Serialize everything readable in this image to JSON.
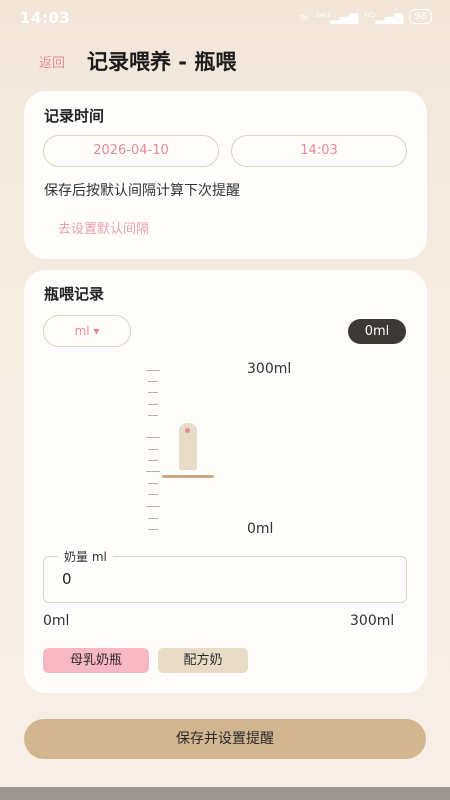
{
  "status_bar": {
    "time": "14:03",
    "signal_1": "ˢ⁴ᴳ▂▄▆",
    "signal_2": "ᴴᴰ▂▄▆",
    "wifi": "≈",
    "battery": "98"
  },
  "nav": {
    "back_label": "返回",
    "title": "记录喂养 - 瓶喂"
  },
  "time_card": {
    "title": "记录时间",
    "date": "2026-04-10",
    "time": "14:03",
    "hint": "保存后按默认间隔计算下次提醒",
    "link_label": "去设置默认间隔"
  },
  "bottle_card": {
    "title": "瓶喂记录",
    "unit_select": "ml ▾",
    "current_volume": "0ml",
    "scale_max_label": "300ml",
    "scale_min_label": "0ml",
    "amount_field": {
      "label": "奶量 ml",
      "value": "0"
    },
    "range_min": "0ml",
    "range_max": "300ml",
    "milk_types": [
      "母乳奶瓶",
      "配方奶"
    ],
    "selected_milk_type": "母乳奶瓶"
  },
  "save_button_label": "保存并设置提醒",
  "colors": {
    "accent_pink": "#e58a98",
    "chip_pink": "#f8b8c3",
    "button_tan": "#d1b690",
    "badge_dark": "#3d3a36"
  }
}
